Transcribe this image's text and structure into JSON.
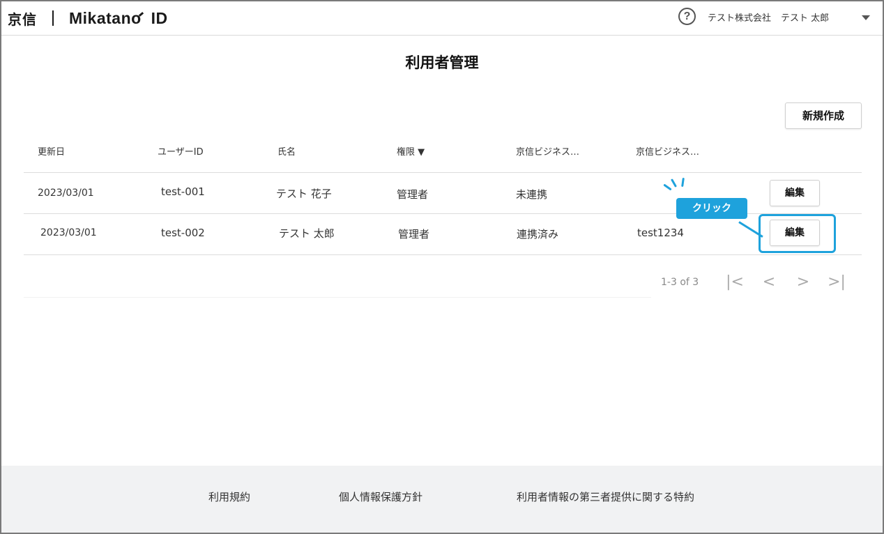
{
  "header": {
    "logo_brand": "京信",
    "logo_product": "Mikatano",
    "logo_product_suffix": "ID",
    "help_icon": "?",
    "company": "テスト株式会社",
    "user_name": "テスト 太郎"
  },
  "page": {
    "title": "利用者管理",
    "new_button": "新規作成"
  },
  "table": {
    "columns": [
      "更新日",
      "ユーザーID",
      "氏名",
      "権限 ▼",
      "京信ビジネス…",
      "京信ビジネス…"
    ],
    "rows": [
      {
        "updated": "2023/03/01",
        "user_id": "test-001",
        "name": "テスト 花子",
        "role": "管理者",
        "link_status": "未連携",
        "biz_id": "",
        "edit": "編集"
      },
      {
        "updated": "2023/03/01",
        "user_id": "test-002",
        "name": "テスト 太郎",
        "role": "管理者",
        "link_status": "連携済み",
        "biz_id": "test1234",
        "edit": "編集"
      }
    ]
  },
  "annotation": {
    "callout": "クリック",
    "accent_color": "#1ea2dc"
  },
  "pagination": {
    "range_text": "1-3 of 3",
    "first_icon": "|<",
    "prev_icon": "<",
    "next_icon": ">",
    "last_icon": ">|"
  },
  "footer": {
    "links": [
      "利用規約",
      "個人情報保護方針",
      "利用者情報の第三者提供に関する特約"
    ]
  }
}
